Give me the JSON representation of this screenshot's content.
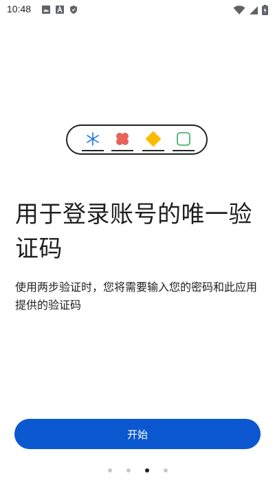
{
  "status_bar": {
    "time": "10:48",
    "left_icons": [
      "image-icon",
      "a-letter-icon",
      "shield-icon"
    ],
    "right_icons": [
      "wifi-icon",
      "cellular-signal-icon",
      "battery-charging-icon"
    ]
  },
  "illustration": {
    "items": [
      "asterisk-icon",
      "red-clover-icon",
      "yellow-diamond-icon",
      "green-rounded-square-icon"
    ],
    "colors": {
      "asterisk": "#1a73e8",
      "clover": "#e8625a",
      "diamond": "#fbbc04",
      "square": "#34a853",
      "outline": "#202124"
    }
  },
  "main": {
    "title": "用于登录账号的唯一验证码",
    "description": "使用两步验证时，您将需要输入您的密码和此应用提供的验证码"
  },
  "actions": {
    "start_label": "开始",
    "accent_color": "#0b57d0"
  },
  "pager": {
    "total_pages": 4,
    "current_page": 3
  }
}
